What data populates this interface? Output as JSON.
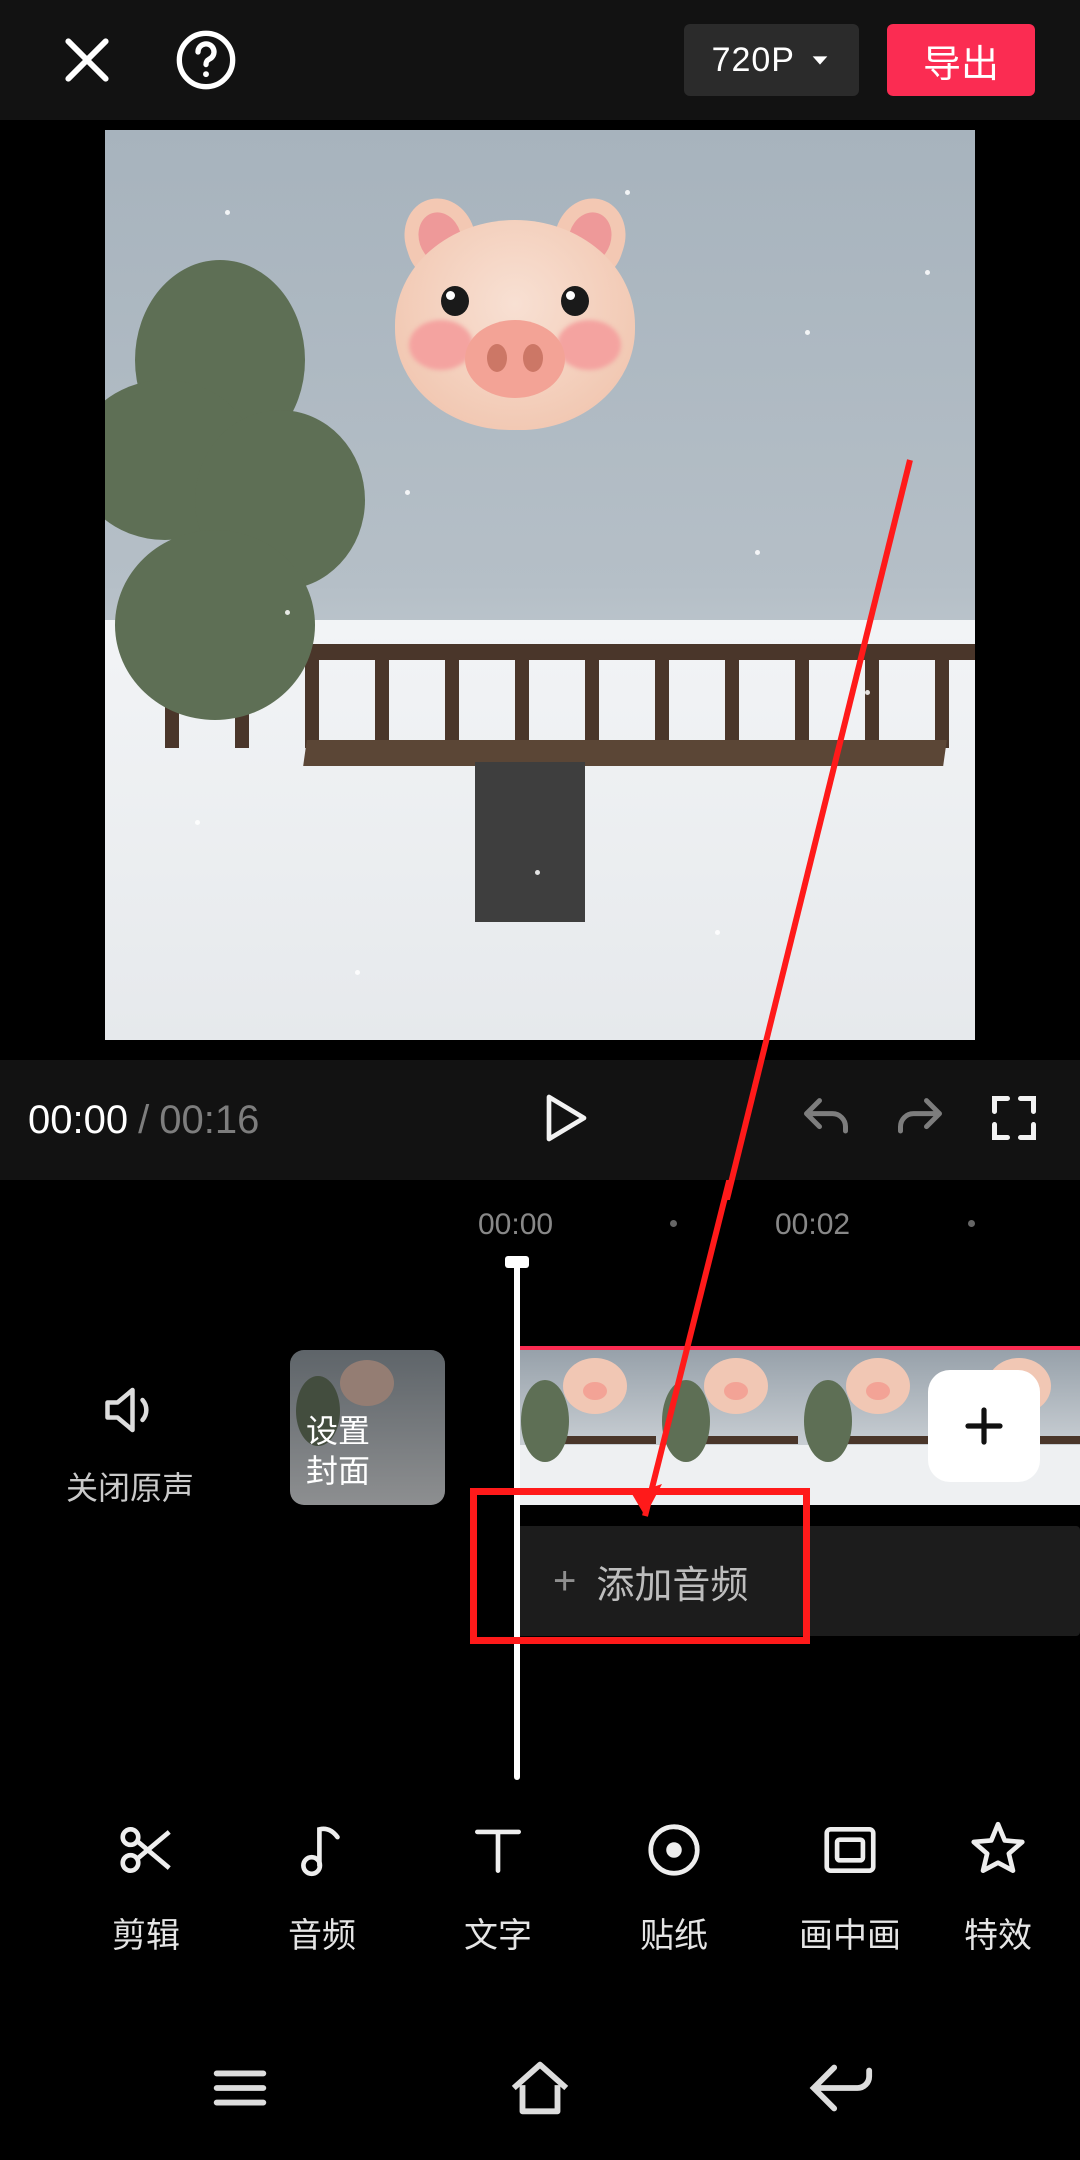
{
  "topbar": {
    "resolution_label": "720P",
    "export_label": "导出"
  },
  "playback": {
    "current_time": "00:00",
    "separator": "/",
    "total_time": "00:16"
  },
  "timeline": {
    "ruler_labels": [
      "00:00",
      "00:02"
    ],
    "mute_label": "关闭原声",
    "cover_label_line1": "设置",
    "cover_label_line2": "封面",
    "add_audio_label": "添加音频"
  },
  "toolbar": {
    "items": [
      {
        "label": "剪辑"
      },
      {
        "label": "音频"
      },
      {
        "label": "文字"
      },
      {
        "label": "贴纸"
      },
      {
        "label": "画中画"
      },
      {
        "label": "特效"
      }
    ]
  }
}
